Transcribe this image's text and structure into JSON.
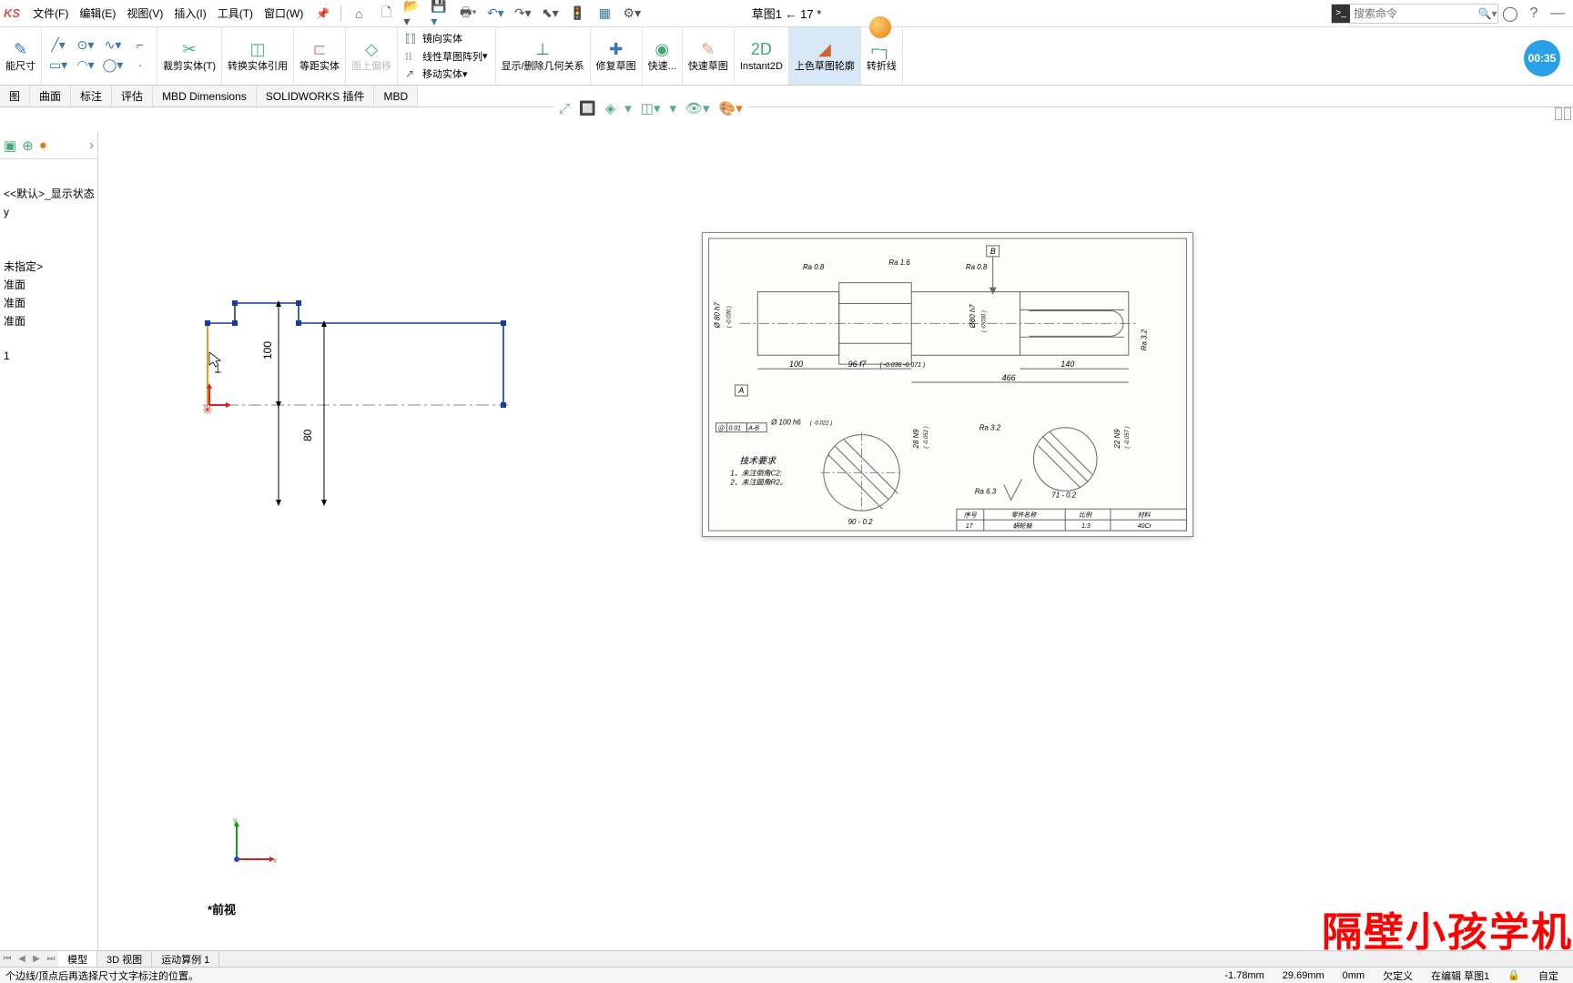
{
  "logo": "KS",
  "menu": [
    "文件(F)",
    "编辑(E)",
    "视图(V)",
    "插入(I)",
    "工具(T)",
    "窗口(W)"
  ],
  "doc_title": "草图1 ← 17 *",
  "search_placeholder": "搜索命令",
  "timer": "00:35",
  "ribbon": {
    "smart_dim": "能尺寸",
    "trim": "裁剪实体(T)",
    "convert": "转换实体引用",
    "offset": "等距实体",
    "surface_offset": "面上偏移",
    "mirror": "镜向实体",
    "linear_pattern": "线性草图阵列",
    "move": "移动实体",
    "show_del": "显示/删除几何关系",
    "repair": "修复草图",
    "quick1": "快速...",
    "quick_sketch": "快速草图",
    "instant2d": "Instant2D",
    "shade": "上色草图轮廓",
    "jog": "转折线"
  },
  "tabs": [
    "图",
    "曲面",
    "标注",
    "评估",
    "MBD Dimensions",
    "SOLIDWORKS 插件",
    "MBD"
  ],
  "tree": {
    "display_state": "<<默认>_显示状态",
    "y": "y",
    "not_specified": "未指定>",
    "plane1": "准面",
    "plane2": "准面",
    "plane3": "准面",
    "sketch": "1"
  },
  "sketch_dims": {
    "d1": "100",
    "d2": "80"
  },
  "view_label": "*前视",
  "bottom_tabs": [
    "模型",
    "3D 视图",
    "运动算例 1"
  ],
  "status": {
    "hint": "个边线/顶点后再选择尺寸文字标注的位置。",
    "x": "-1.78mm",
    "y": "29.69mm",
    "z": "0mm",
    "constraint": "欠定义",
    "mode": "在编辑 草图1",
    "auto": "自定"
  },
  "watermark": "隔壁小孩学机",
  "ref": {
    "ra08": "Ra 0.8",
    "ra16": "Ra 1.6",
    "ra32": "Ra 3.2",
    "ra63": "Ra 6.3",
    "d100": "100",
    "d96": "96 f7",
    "d96tol": "( -0.036\n-0.071 )",
    "d466": "466",
    "d140": "140",
    "dia80": "Ø 80 h7",
    "dia80tol": "( -0.030 )",
    "dia80b": "Ø80 h7",
    "dia80btol": "( -0.030 )",
    "dia100": "Ø 100 h6",
    "dia100tol": "( -0.022 )",
    "d28": "28 N9",
    "d28tol": "( -0.052 )",
    "d22": "22 N9",
    "d22tol": "( -0.057 )",
    "d90": "90 - 0.2",
    "d71": "71 - 0.2",
    "gtol": "0.01",
    "gtolref": "A-B",
    "tech_title": "技术要求",
    "tech1": "1、未注倒角C2;",
    "tech2": "2、未注圆角R2。",
    "th_num": "序号",
    "th_name": "零件名称",
    "th_scale": "比例",
    "th_mat": "材料",
    "tv_num": "17",
    "tv_name": "蜗轮轴",
    "tv_scale": "1:3",
    "tv_mat": "40Cr",
    "datumA": "A",
    "datumB": "B"
  }
}
